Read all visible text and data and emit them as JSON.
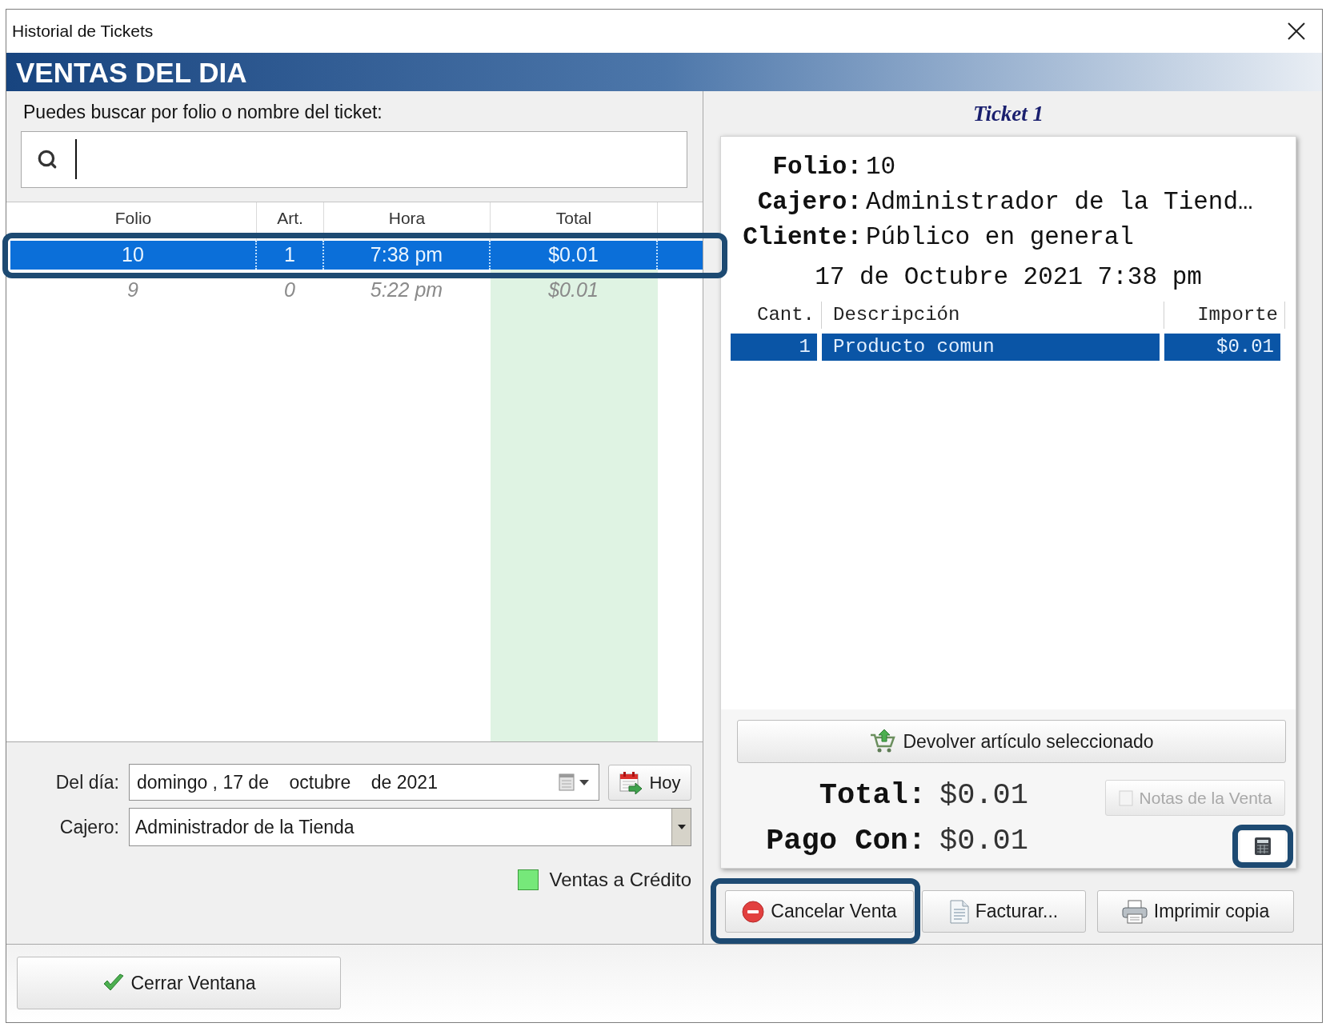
{
  "window": {
    "title": "Historial de Tickets"
  },
  "header": {
    "title": "VENTAS DEL DIA"
  },
  "search": {
    "label": "Puedes buscar por folio o nombre del ticket:"
  },
  "tickets_table": {
    "columns": [
      {
        "label": "Folio",
        "shaded": false
      },
      {
        "label": "Art.",
        "shaded": false
      },
      {
        "label": "Hora",
        "shaded": false
      },
      {
        "label": "Total",
        "shaded": true
      }
    ],
    "rows": [
      {
        "cells": [
          "10",
          "1",
          "7:38 pm",
          "$0.01"
        ],
        "selected": true,
        "dimmed": false,
        "highlighted": true
      },
      {
        "cells": [
          "9",
          "0",
          "5:22 pm",
          "$0.01"
        ],
        "selected": false,
        "dimmed": true,
        "highlighted": false
      }
    ]
  },
  "filters": {
    "date_label": "Del día:",
    "date_value": "domingo , 17 de    octubre    de 2021",
    "today_button": "Hoy",
    "cashier_label": "Cajero:",
    "cashier_value": "Administrador de la Tienda"
  },
  "legend": [
    {
      "label": "Ventas a Crédito",
      "color": "#76e87a"
    }
  ],
  "ticket": {
    "title": "Ticket 1",
    "fields": [
      {
        "label": "Folio:",
        "value": "10"
      },
      {
        "label": "Cajero:",
        "value": "Administrador de la Tiend…"
      },
      {
        "label": "Cliente:",
        "value": "Público en general"
      }
    ],
    "date": "17 de Octubre 2021 7:38 pm",
    "items": {
      "columns": [
        "Cant.",
        "Descripción",
        "Importe"
      ],
      "rows": [
        {
          "cells": [
            "1",
            "Producto comun",
            "$0.01"
          ],
          "selected": true
        }
      ]
    },
    "return_button": "Devolver artículo seleccionado",
    "totals": [
      {
        "label": "Total:",
        "value": "$0.01"
      },
      {
        "label": "Pago Con:",
        "value": "$0.01"
      }
    ],
    "notes_button": {
      "label": "Notas de la Venta",
      "disabled": true
    },
    "calculator_button": {
      "highlighted": true
    }
  },
  "actions": {
    "cancel_button": {
      "label": "Cancelar Venta",
      "highlighted": true
    },
    "invoice_button": {
      "label": "Facturar..."
    },
    "print_button": {
      "label": "Imprimir copia"
    }
  },
  "footer": {
    "close_button": "Cerrar Ventana"
  }
}
